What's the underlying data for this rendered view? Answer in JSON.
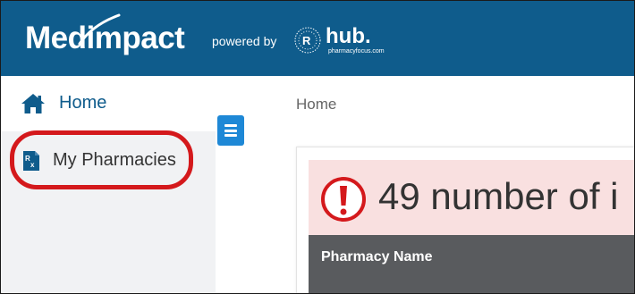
{
  "header": {
    "brand": "Medimpact",
    "powered_by": "powered by",
    "hub_name": "hub.",
    "hub_subtext": "pharmacyfocus.com",
    "background_color": "#0f5c8c"
  },
  "sidebar": {
    "items": [
      {
        "label": "Home",
        "icon": "home-icon",
        "color": "#0f5c8c"
      },
      {
        "label": "My Pharmacies",
        "icon": "rx-document-icon",
        "color": "#333333"
      }
    ],
    "highlight_color": "#d4191c"
  },
  "toggle": {
    "icon": "hamburger-menu-icon",
    "color": "#1e88d6"
  },
  "breadcrumb": {
    "current": "Home"
  },
  "alert": {
    "icon": "exclamation-circle-icon",
    "text": "49 number of i",
    "background_color": "#f9e0e0",
    "icon_color": "#d4191c"
  },
  "table": {
    "columns": [
      "Pharmacy Name"
    ],
    "header_color": "#595b5e"
  }
}
